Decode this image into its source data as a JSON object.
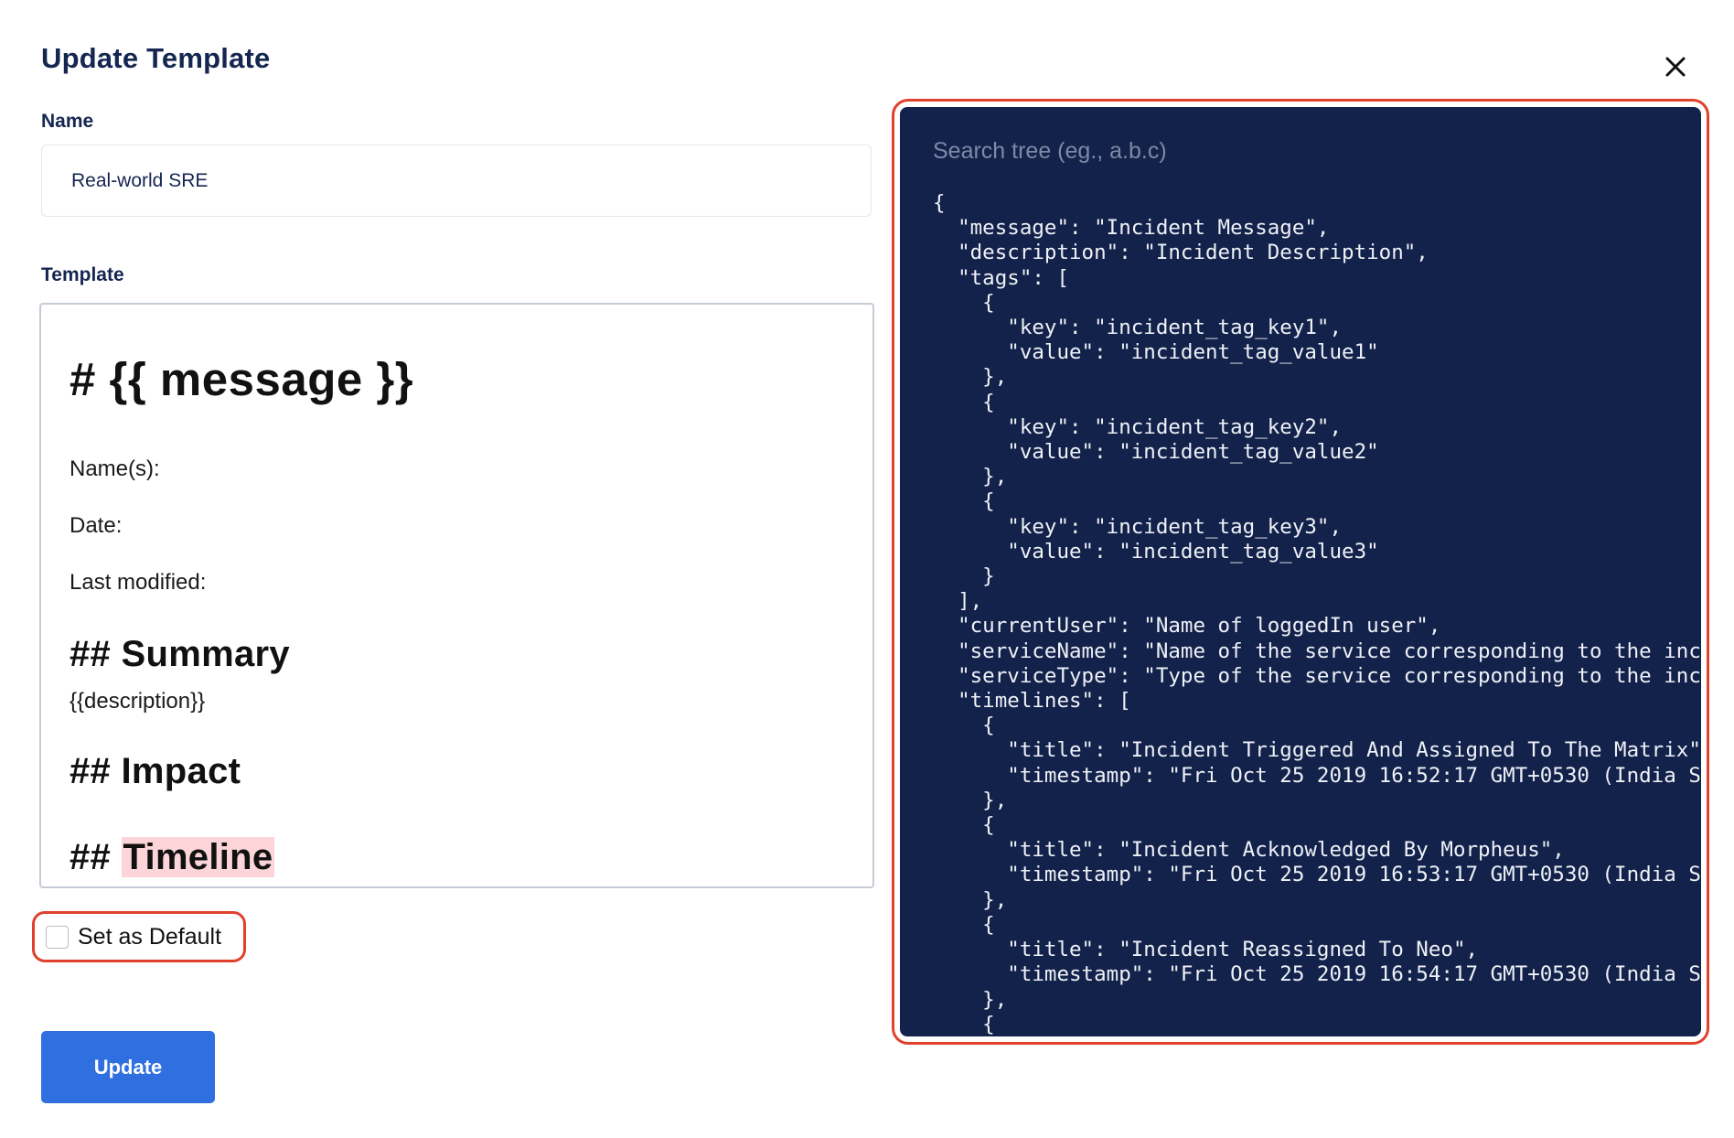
{
  "dialog": {
    "title": "Update Template",
    "close_icon": "close-icon"
  },
  "name_field": {
    "label": "Name",
    "value": "Real-world SRE"
  },
  "template_field": {
    "label": "Template",
    "lines": {
      "heading": "# {{ message }}",
      "names": "Name(s):",
      "date": "Date:",
      "last_modified": "Last modified:",
      "summary_heading": "## Summary",
      "description": "{{description}}",
      "impact_heading": "## Impact",
      "timeline_prefix": "## ",
      "timeline_word": "Timeline"
    }
  },
  "set_default": {
    "label": "Set as Default",
    "checked": false
  },
  "update_button": {
    "label": "Update"
  },
  "tree": {
    "search_placeholder": "Search tree (eg., a.b.c)",
    "json_text": "{\n  \"message\": \"Incident Message\",\n  \"description\": \"Incident Description\",\n  \"tags\": [\n    {\n      \"key\": \"incident_tag_key1\",\n      \"value\": \"incident_tag_value1\"\n    },\n    {\n      \"key\": \"incident_tag_key2\",\n      \"value\": \"incident_tag_value2\"\n    },\n    {\n      \"key\": \"incident_tag_key3\",\n      \"value\": \"incident_tag_value3\"\n    }\n  ],\n  \"currentUser\": \"Name of loggedIn user\",\n  \"serviceName\": \"Name of the service corresponding to the incident\n  \"serviceType\": \"Type of the service corresponding to the incident\n  \"timelines\": [\n    {\n      \"title\": \"Incident Triggered And Assigned To The Matrix\",\n      \"timestamp\": \"Fri Oct 25 2019 16:52:17 GMT+0530 (India Standa\n    },\n    {\n      \"title\": \"Incident Acknowledged By Morpheus\",\n      \"timestamp\": \"Fri Oct 25 2019 16:53:17 GMT+0530 (India Standa\n    },\n    {\n      \"title\": \"Incident Reassigned To Neo\",\n      \"timestamp\": \"Fri Oct 25 2019 16:54:17 GMT+0530 (India Standa\n    },\n    {"
  },
  "colors": {
    "title_text": "#152651",
    "primary_button": "#2f6fdf",
    "tree_background": "#13224a",
    "highlight_outline": "#e0412d",
    "timeline_highlight": "#fbd5d8"
  }
}
